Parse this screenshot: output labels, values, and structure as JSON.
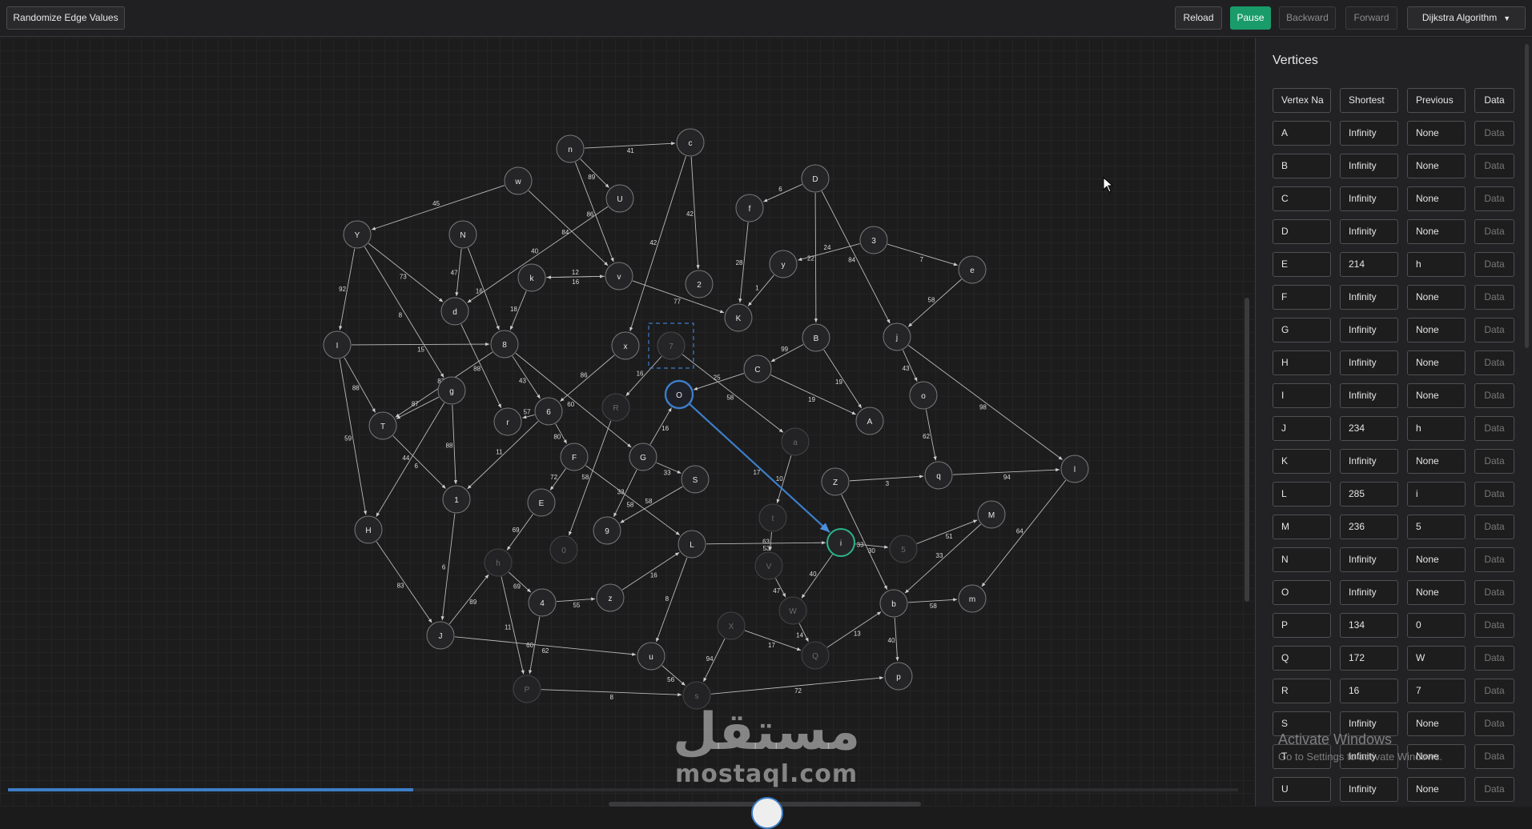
{
  "toolbar": {
    "randomize_label": "Randomize Edge Values",
    "reload_label": "Reload",
    "pause_label": "Pause",
    "backward_label": "Backward",
    "forward_label": "Forward",
    "algorithm_label": "Dijkstra Algorithm",
    "colors": {
      "pause_bg": "#1a9c6a",
      "highlight": "#3d7ec7",
      "current": "#2bb58a"
    }
  },
  "panel": {
    "title": "Vertices",
    "headers": [
      "Vertex Na",
      "Shortest",
      "Previous",
      "Data"
    ],
    "rows": [
      [
        "A",
        "Infinity",
        "None",
        "Data"
      ],
      [
        "B",
        "Infinity",
        "None",
        "Data"
      ],
      [
        "C",
        "Infinity",
        "None",
        "Data"
      ],
      [
        "D",
        "Infinity",
        "None",
        "Data"
      ],
      [
        "E",
        "214",
        "h",
        "Data"
      ],
      [
        "F",
        "Infinity",
        "None",
        "Data"
      ],
      [
        "G",
        "Infinity",
        "None",
        "Data"
      ],
      [
        "H",
        "Infinity",
        "None",
        "Data"
      ],
      [
        "I",
        "Infinity",
        "None",
        "Data"
      ],
      [
        "J",
        "234",
        "h",
        "Data"
      ],
      [
        "K",
        "Infinity",
        "None",
        "Data"
      ],
      [
        "L",
        "285",
        "i",
        "Data"
      ],
      [
        "M",
        "236",
        "5",
        "Data"
      ],
      [
        "N",
        "Infinity",
        "None",
        "Data"
      ],
      [
        "O",
        "Infinity",
        "None",
        "Data"
      ],
      [
        "P",
        "134",
        "0",
        "Data"
      ],
      [
        "Q",
        "172",
        "W",
        "Data"
      ],
      [
        "R",
        "16",
        "7",
        "Data"
      ],
      [
        "S",
        "Infinity",
        "None",
        "Data"
      ],
      [
        "T",
        "Infinity",
        "None",
        "Data"
      ],
      [
        "U",
        "Infinity",
        "None",
        "Data"
      ]
    ]
  },
  "overlay": {
    "activate_title": "Activate Windows",
    "activate_sub": "Go to Settings to activate Windows.",
    "watermark_ar": "مستقل",
    "watermark_en": "mostaql.com"
  },
  "graph": {
    "nodes": [
      {
        "id": "n",
        "label": "n",
        "state": "normal"
      },
      {
        "id": "c",
        "label": "c",
        "state": "normal"
      },
      {
        "id": "U",
        "label": "U",
        "state": "normal"
      },
      {
        "id": "w",
        "label": "w",
        "state": "normal"
      },
      {
        "id": "Y",
        "label": "Y",
        "state": "normal"
      },
      {
        "id": "N",
        "label": "N",
        "state": "normal"
      },
      {
        "id": "k",
        "label": "k",
        "state": "normal"
      },
      {
        "id": "v",
        "label": "v",
        "state": "normal"
      },
      {
        "id": "2",
        "label": "2",
        "state": "normal"
      },
      {
        "id": "d",
        "label": "d",
        "state": "normal"
      },
      {
        "id": "I",
        "label": "I",
        "state": "normal"
      },
      {
        "id": "8",
        "label": "8",
        "state": "normal"
      },
      {
        "id": "x",
        "label": "x",
        "state": "normal"
      },
      {
        "id": "7",
        "label": "7",
        "state": "selected"
      },
      {
        "id": "D",
        "label": "D",
        "state": "normal"
      },
      {
        "id": "f",
        "label": "f",
        "state": "normal"
      },
      {
        "id": "y",
        "label": "y",
        "state": "normal"
      },
      {
        "id": "3",
        "label": "3",
        "state": "normal"
      },
      {
        "id": "e",
        "label": "e",
        "state": "normal"
      },
      {
        "id": "K",
        "label": "K",
        "state": "normal"
      },
      {
        "id": "B",
        "label": "B",
        "state": "normal"
      },
      {
        "id": "j",
        "label": "j",
        "state": "normal"
      },
      {
        "id": "C",
        "label": "C",
        "state": "normal"
      },
      {
        "id": "O",
        "label": "O",
        "state": "active"
      },
      {
        "id": "R",
        "label": "R",
        "state": "dim"
      },
      {
        "id": "g",
        "label": "g",
        "state": "normal"
      },
      {
        "id": "T",
        "label": "T",
        "state": "normal"
      },
      {
        "id": "r",
        "label": "r",
        "state": "normal"
      },
      {
        "id": "6",
        "label": "6",
        "state": "normal"
      },
      {
        "id": "o",
        "label": "o",
        "state": "normal"
      },
      {
        "id": "A",
        "label": "A",
        "state": "normal"
      },
      {
        "id": "a",
        "label": "a",
        "state": "dim"
      },
      {
        "id": "G",
        "label": "G",
        "state": "normal"
      },
      {
        "id": "F",
        "label": "F",
        "state": "normal"
      },
      {
        "id": "S",
        "label": "S",
        "state": "normal"
      },
      {
        "id": "Z",
        "label": "Z",
        "state": "normal"
      },
      {
        "id": "q",
        "label": "q",
        "state": "normal"
      },
      {
        "id": "l",
        "label": "l",
        "state": "normal"
      },
      {
        "id": "1",
        "label": "1",
        "state": "normal"
      },
      {
        "id": "E",
        "label": "E",
        "state": "normal"
      },
      {
        "id": "H",
        "label": "H",
        "state": "normal"
      },
      {
        "id": "t",
        "label": "t",
        "state": "dim"
      },
      {
        "id": "9",
        "label": "9",
        "state": "normal"
      },
      {
        "id": "L",
        "label": "L",
        "state": "normal"
      },
      {
        "id": "i",
        "label": "i",
        "state": "current"
      },
      {
        "id": "5",
        "label": "5",
        "state": "dim"
      },
      {
        "id": "M",
        "label": "M",
        "state": "normal"
      },
      {
        "id": "0",
        "label": "0",
        "state": "dim"
      },
      {
        "id": "h",
        "label": "h",
        "state": "dim"
      },
      {
        "id": "V",
        "label": "V",
        "state": "dim"
      },
      {
        "id": "4",
        "label": "4",
        "state": "normal"
      },
      {
        "id": "z",
        "label": "z",
        "state": "normal"
      },
      {
        "id": "W",
        "label": "W",
        "state": "dim"
      },
      {
        "id": "b",
        "label": "b",
        "state": "normal"
      },
      {
        "id": "m",
        "label": "m",
        "state": "normal"
      },
      {
        "id": "J",
        "label": "J",
        "state": "normal"
      },
      {
        "id": "X",
        "label": "X",
        "state": "dim"
      },
      {
        "id": "u",
        "label": "u",
        "state": "normal"
      },
      {
        "id": "Q",
        "label": "Q",
        "state": "dim"
      },
      {
        "id": "p",
        "label": "p",
        "state": "normal"
      },
      {
        "id": "P",
        "label": "P",
        "state": "dim"
      },
      {
        "id": "s",
        "label": "s",
        "state": "dim"
      }
    ],
    "edges": [
      {
        "from": "n",
        "to": "c",
        "w": "41"
      },
      {
        "from": "n",
        "to": "U",
        "w": "89"
      },
      {
        "from": "n",
        "to": "v",
        "w": "86"
      },
      {
        "from": "c",
        "to": "2",
        "w": "42"
      },
      {
        "from": "c",
        "to": "x",
        "w": "42"
      },
      {
        "from": "w",
        "to": "Y",
        "w": "45"
      },
      {
        "from": "w",
        "to": "v",
        "w": "84"
      },
      {
        "from": "U",
        "to": "d",
        "w": "40"
      },
      {
        "from": "Y",
        "to": "d",
        "w": "73"
      },
      {
        "from": "Y",
        "to": "I",
        "w": "92"
      },
      {
        "from": "Y",
        "to": "g",
        "w": "8"
      },
      {
        "from": "N",
        "to": "d",
        "w": "47"
      },
      {
        "from": "N",
        "to": "8",
        "w": "16"
      },
      {
        "from": "k",
        "to": "v",
        "w": "16"
      },
      {
        "from": "k",
        "to": "8",
        "w": "18"
      },
      {
        "from": "v",
        "to": "K",
        "w": "77"
      },
      {
        "from": "v",
        "to": "k",
        "w": "12"
      },
      {
        "from": "d",
        "to": "r",
        "w": "88"
      },
      {
        "from": "I",
        "to": "8",
        "w": "15"
      },
      {
        "from": "I",
        "to": "T",
        "w": "88"
      },
      {
        "from": "I",
        "to": "H",
        "w": "59"
      },
      {
        "from": "8",
        "to": "T",
        "w": "87"
      },
      {
        "from": "8",
        "to": "6",
        "w": "43"
      },
      {
        "from": "8",
        "to": "G",
        "w": "60"
      },
      {
        "from": "x",
        "to": "6",
        "w": "86"
      },
      {
        "from": "7",
        "to": "R",
        "w": "16"
      },
      {
        "from": "7",
        "to": "a",
        "w": "58"
      },
      {
        "from": "D",
        "to": "f",
        "w": "6"
      },
      {
        "from": "D",
        "to": "B",
        "w": "22"
      },
      {
        "from": "D",
        "to": "j",
        "w": "84"
      },
      {
        "from": "f",
        "to": "K",
        "w": "28"
      },
      {
        "from": "y",
        "to": "K",
        "w": "1"
      },
      {
        "from": "3",
        "to": "y",
        "w": "24"
      },
      {
        "from": "3",
        "to": "e",
        "w": "7"
      },
      {
        "from": "e",
        "to": "j",
        "w": "58"
      },
      {
        "from": "B",
        "to": "C",
        "w": "99"
      },
      {
        "from": "B",
        "to": "A",
        "w": "19"
      },
      {
        "from": "C",
        "to": "A",
        "w": "19"
      },
      {
        "from": "C",
        "to": "O",
        "w": "25"
      },
      {
        "from": "j",
        "to": "o",
        "w": "43"
      },
      {
        "from": "j",
        "to": "l",
        "w": "98"
      },
      {
        "from": "o",
        "to": "q",
        "w": "62"
      },
      {
        "from": "g",
        "to": "T",
        "w": "87"
      },
      {
        "from": "g",
        "to": "1",
        "w": "88"
      },
      {
        "from": "g",
        "to": "H",
        "w": "44"
      },
      {
        "from": "T",
        "to": "1",
        "w": "6"
      },
      {
        "from": "6",
        "to": "r",
        "w": "57"
      },
      {
        "from": "6",
        "to": "1",
        "w": "11"
      },
      {
        "from": "6",
        "to": "F",
        "w": "80"
      },
      {
        "from": "G",
        "to": "O",
        "w": "16"
      },
      {
        "from": "G",
        "to": "S",
        "w": "33"
      },
      {
        "from": "G",
        "to": "9",
        "w": "33"
      },
      {
        "from": "F",
        "to": "E",
        "w": "72"
      },
      {
        "from": "F",
        "to": "L",
        "w": "58"
      },
      {
        "from": "R",
        "to": "0",
        "w": "58"
      },
      {
        "from": "S",
        "to": "9",
        "w": "58"
      },
      {
        "from": "a",
        "to": "t",
        "w": "10"
      },
      {
        "from": "Z",
        "to": "q",
        "w": "3"
      },
      {
        "from": "Z",
        "to": "b",
        "w": "33"
      },
      {
        "from": "q",
        "to": "l",
        "w": "94"
      },
      {
        "from": "l",
        "to": "m",
        "w": "64"
      },
      {
        "from": "1",
        "to": "J",
        "w": "6"
      },
      {
        "from": "H",
        "to": "J",
        "w": "83"
      },
      {
        "from": "E",
        "to": "h",
        "w": "69"
      },
      {
        "from": "L",
        "to": "i",
        "w": "53"
      },
      {
        "from": "L",
        "to": "u",
        "w": "8"
      },
      {
        "from": "i",
        "to": "5",
        "w": "30"
      },
      {
        "from": "i",
        "to": "W",
        "w": "40"
      },
      {
        "from": "t",
        "to": "V",
        "w": "63"
      },
      {
        "from": "5",
        "to": "M",
        "w": "51"
      },
      {
        "from": "M",
        "to": "b",
        "w": "33"
      },
      {
        "from": "b",
        "to": "m",
        "w": "58"
      },
      {
        "from": "b",
        "to": "p",
        "w": "40"
      },
      {
        "from": "Q",
        "to": "b",
        "w": "13"
      },
      {
        "from": "V",
        "to": "W",
        "w": "47"
      },
      {
        "from": "W",
        "to": "Q",
        "w": "14"
      },
      {
        "from": "h",
        "to": "4",
        "w": "69"
      },
      {
        "from": "h",
        "to": "P",
        "w": "11"
      },
      {
        "from": "4",
        "to": "z",
        "w": "55"
      },
      {
        "from": "4",
        "to": "P",
        "w": "60"
      },
      {
        "from": "z",
        "to": "L",
        "w": "16"
      },
      {
        "from": "J",
        "to": "h",
        "w": "89"
      },
      {
        "from": "J",
        "to": "u",
        "w": "62"
      },
      {
        "from": "X",
        "to": "Q",
        "w": "17"
      },
      {
        "from": "X",
        "to": "s",
        "w": "94"
      },
      {
        "from": "u",
        "to": "s",
        "w": "56"
      },
      {
        "from": "P",
        "to": "s",
        "w": "8"
      },
      {
        "from": "s",
        "to": "p",
        "w": "72"
      },
      {
        "from": "O",
        "to": "i",
        "w": "17",
        "highlight": true
      }
    ]
  }
}
